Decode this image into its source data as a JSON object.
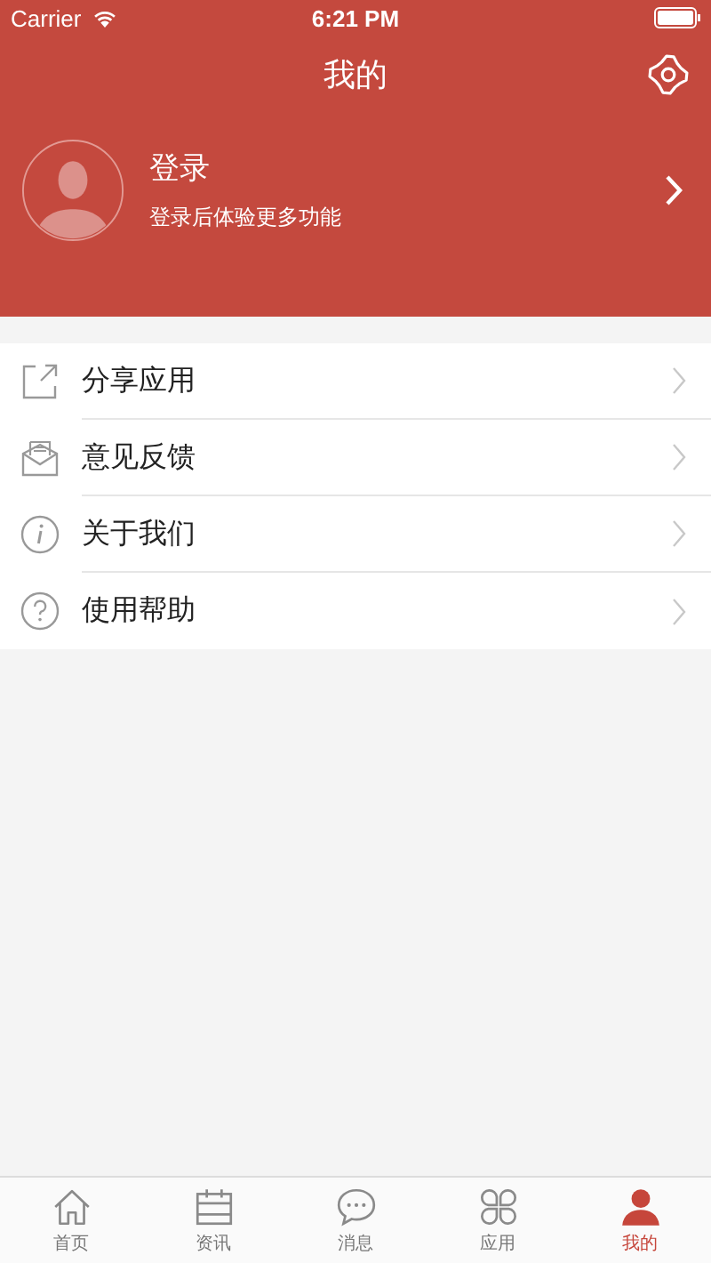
{
  "status_bar": {
    "carrier": "Carrier",
    "time": "6:21 PM"
  },
  "header": {
    "title": "我的"
  },
  "profile": {
    "name": "登录",
    "subtitle": "登录后体验更多功能"
  },
  "menu": [
    {
      "kind": "share",
      "label": "分享应用"
    },
    {
      "kind": "feedback",
      "label": "意见反馈"
    },
    {
      "kind": "about",
      "label": "关于我们"
    },
    {
      "kind": "help",
      "label": "使用帮助"
    }
  ],
  "tab_bar": [
    {
      "kind": "home",
      "label": "首页",
      "selected": false
    },
    {
      "kind": "news",
      "label": "资讯",
      "selected": false
    },
    {
      "kind": "messages",
      "label": "消息",
      "selected": false
    },
    {
      "kind": "apps",
      "label": "应用",
      "selected": false
    },
    {
      "kind": "me",
      "label": "我的",
      "selected": true
    }
  ]
}
